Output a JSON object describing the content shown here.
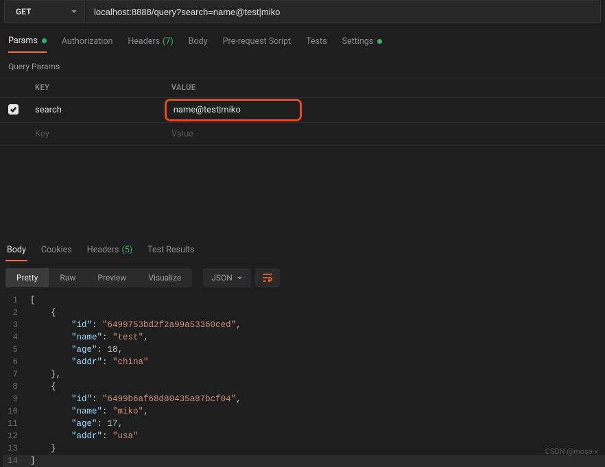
{
  "request": {
    "method": "GET",
    "url": "localhost:8888/query?search=name@test|miko"
  },
  "tabs": {
    "request": [
      {
        "label": "Params",
        "active": true,
        "dot": true
      },
      {
        "label": "Authorization"
      },
      {
        "label": "Headers",
        "count": "(7)"
      },
      {
        "label": "Body"
      },
      {
        "label": "Pre-request Script"
      },
      {
        "label": "Tests"
      },
      {
        "label": "Settings",
        "dot": true
      }
    ],
    "response": [
      {
        "label": "Body",
        "active": true
      },
      {
        "label": "Cookies"
      },
      {
        "label": "Headers",
        "count": "(5)"
      },
      {
        "label": "Test Results"
      }
    ]
  },
  "queryParams": {
    "section": "Query Params",
    "headers": {
      "key": "KEY",
      "value": "VALUE"
    },
    "rows": [
      {
        "checked": true,
        "key": "search",
        "value": "name@test|miko",
        "highlight": true
      },
      {
        "key": "Key",
        "value": "Value",
        "placeholder": true
      }
    ]
  },
  "toolbar": {
    "views": [
      "Pretty",
      "Raw",
      "Preview",
      "Visualize"
    ],
    "activeView": "Pretty",
    "lang": "JSON"
  },
  "code": [
    {
      "n": 1,
      "t": [
        {
          "c": "tok-br",
          "v": "["
        }
      ]
    },
    {
      "n": 2,
      "t": [
        {
          "c": "",
          "v": "    "
        },
        {
          "c": "tok-br",
          "v": "{"
        }
      ]
    },
    {
      "n": 3,
      "t": [
        {
          "c": "",
          "v": "        "
        },
        {
          "c": "tok-key",
          "v": "\"id\""
        },
        {
          "c": "tok-pun",
          "v": ": "
        },
        {
          "c": "tok-str",
          "v": "\"6499753bd2f2a99a53360ced\""
        },
        {
          "c": "tok-pun",
          "v": ","
        }
      ]
    },
    {
      "n": 4,
      "t": [
        {
          "c": "",
          "v": "        "
        },
        {
          "c": "tok-key",
          "v": "\"name\""
        },
        {
          "c": "tok-pun",
          "v": ": "
        },
        {
          "c": "tok-str",
          "v": "\"test\""
        },
        {
          "c": "tok-pun",
          "v": ","
        }
      ]
    },
    {
      "n": 5,
      "t": [
        {
          "c": "",
          "v": "        "
        },
        {
          "c": "tok-key",
          "v": "\"age\""
        },
        {
          "c": "tok-pun",
          "v": ": "
        },
        {
          "c": "tok-num",
          "v": "18"
        },
        {
          "c": "tok-pun",
          "v": ","
        }
      ]
    },
    {
      "n": 6,
      "t": [
        {
          "c": "",
          "v": "        "
        },
        {
          "c": "tok-key",
          "v": "\"addr\""
        },
        {
          "c": "tok-pun",
          "v": ": "
        },
        {
          "c": "tok-str",
          "v": "\"china\""
        }
      ]
    },
    {
      "n": 7,
      "t": [
        {
          "c": "",
          "v": "    "
        },
        {
          "c": "tok-br",
          "v": "}"
        },
        {
          "c": "tok-pun",
          "v": ","
        }
      ]
    },
    {
      "n": 8,
      "t": [
        {
          "c": "",
          "v": "    "
        },
        {
          "c": "tok-br",
          "v": "{"
        }
      ]
    },
    {
      "n": 9,
      "t": [
        {
          "c": "",
          "v": "        "
        },
        {
          "c": "tok-key",
          "v": "\"id\""
        },
        {
          "c": "tok-pun",
          "v": ": "
        },
        {
          "c": "tok-str",
          "v": "\"6499b6af68d80435a87bcf04\""
        },
        {
          "c": "tok-pun",
          "v": ","
        }
      ]
    },
    {
      "n": 10,
      "t": [
        {
          "c": "",
          "v": "        "
        },
        {
          "c": "tok-key",
          "v": "\"name\""
        },
        {
          "c": "tok-pun",
          "v": ": "
        },
        {
          "c": "tok-str",
          "v": "\"miko\""
        },
        {
          "c": "tok-pun",
          "v": ","
        }
      ]
    },
    {
      "n": 11,
      "t": [
        {
          "c": "",
          "v": "        "
        },
        {
          "c": "tok-key",
          "v": "\"age\""
        },
        {
          "c": "tok-pun",
          "v": ": "
        },
        {
          "c": "tok-num",
          "v": "17"
        },
        {
          "c": "tok-pun",
          "v": ","
        }
      ]
    },
    {
      "n": 12,
      "t": [
        {
          "c": "",
          "v": "        "
        },
        {
          "c": "tok-key",
          "v": "\"addr\""
        },
        {
          "c": "tok-pun",
          "v": ": "
        },
        {
          "c": "tok-str",
          "v": "\"usa\""
        }
      ]
    },
    {
      "n": 13,
      "t": [
        {
          "c": "",
          "v": "    "
        },
        {
          "c": "tok-br",
          "v": "}"
        }
      ]
    },
    {
      "n": 14,
      "t": [
        {
          "c": "tok-br",
          "v": "]"
        }
      ],
      "cursor": true
    }
  ],
  "watermark": "CSDN @mose-x"
}
